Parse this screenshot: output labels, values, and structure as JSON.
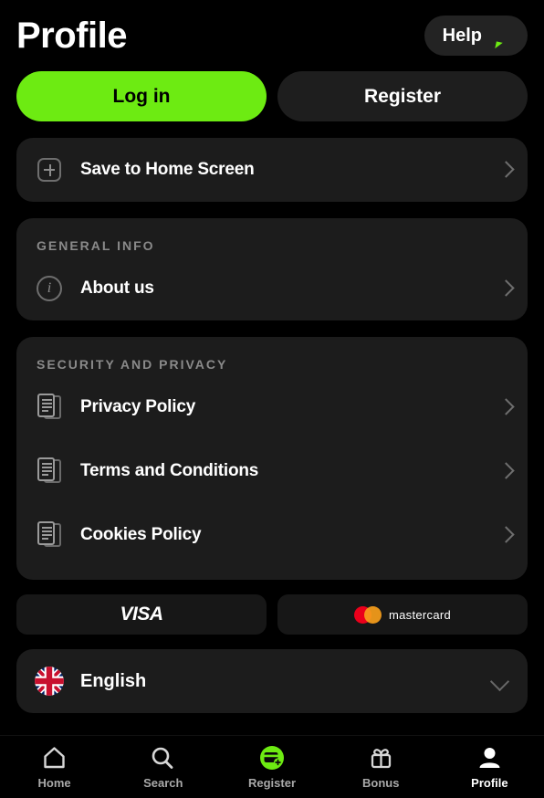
{
  "theme": {
    "accent": "#6DEB12",
    "background": "#000000",
    "card": "#1C1C1C",
    "muted_text": "#8A8A8A",
    "mastercard_red": "#EB001B",
    "mastercard_orange": "#F79E1B"
  },
  "header": {
    "title": "Profile",
    "help_label": "Help",
    "help_icon": "chat-bubble-icon"
  },
  "auth": {
    "login_label": "Log in",
    "register_label": "Register"
  },
  "save_home": {
    "label": "Save to Home Screen",
    "icon": "plus-square-icon",
    "chevron": "chevron-right-icon"
  },
  "general_info": {
    "section_label": "GENERAL INFO",
    "items": [
      {
        "label": "About us",
        "icon": "info-circle-icon"
      }
    ]
  },
  "security_privacy": {
    "section_label": "SECURITY AND PRIVACY",
    "items": [
      {
        "label": "Privacy Policy",
        "icon": "document-icon"
      },
      {
        "label": "Terms and Conditions",
        "icon": "document-icon"
      },
      {
        "label": "Cookies Policy",
        "icon": "document-icon"
      }
    ]
  },
  "payments": [
    {
      "name": "VISA",
      "icon": "visa-logo"
    },
    {
      "name": "mastercard",
      "icon": "mastercard-logo"
    }
  ],
  "language": {
    "value": "English",
    "flag": "uk-flag-icon",
    "chevron": "chevron-down-icon"
  },
  "bottom_nav": {
    "items": [
      {
        "label": "Home",
        "icon": "home-icon",
        "active": false
      },
      {
        "label": "Search",
        "icon": "search-icon",
        "active": false
      },
      {
        "label": "Register",
        "icon": "register-card-icon",
        "active": false
      },
      {
        "label": "Bonus",
        "icon": "gift-icon",
        "active": false
      },
      {
        "label": "Profile",
        "icon": "person-icon",
        "active": true
      }
    ]
  }
}
